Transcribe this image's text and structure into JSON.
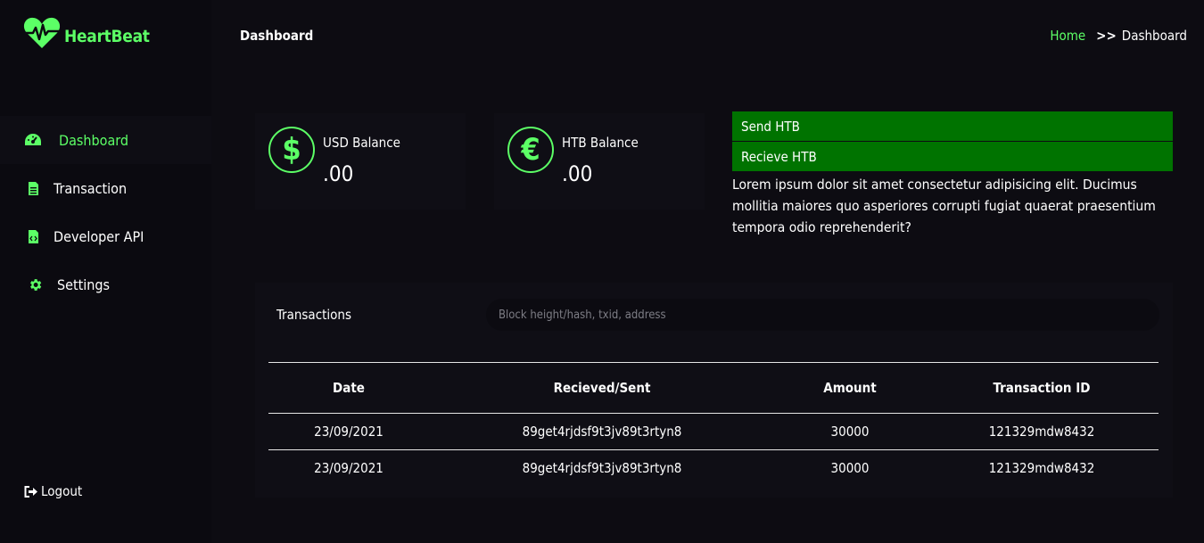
{
  "brand": {
    "name": "HeartBeat",
    "color": "#5cff66"
  },
  "header": {
    "title": "Dashboard",
    "breadcrumb": {
      "home": "Home",
      "separator": ">>",
      "current": "Dashboard"
    }
  },
  "sidebar": {
    "items": [
      {
        "label": "Dashboard",
        "icon": "speedometer-icon",
        "active": true
      },
      {
        "label": "Transaction",
        "icon": "document-icon",
        "active": false
      },
      {
        "label": "Developer API",
        "icon": "code-file-icon",
        "active": false
      },
      {
        "label": "Settings",
        "icon": "gear-icon",
        "active": false
      }
    ],
    "logout": "Logout"
  },
  "balances": {
    "usd": {
      "label": "USD Balance",
      "value": ".00",
      "icon": "dollar-icon",
      "symbol": "$"
    },
    "htb": {
      "label": "HTB Balance",
      "value": ".00",
      "icon": "euro-icon",
      "symbol": "€"
    }
  },
  "actions": {
    "send": "Send HTB",
    "receive": "Recieve HTB",
    "text": "Lorem ipsum dolor sit amet consectetur adipisicing elit. Ducimus mollitia maiores quo asperiores corrupti fugiat quaerat praesentium tempora odio reprehenderit?",
    "button_color": "#007300"
  },
  "transactions": {
    "title": "Transactions",
    "search_placeholder": "Block height/hash, txid, address",
    "columns": [
      "Date",
      "Recieved/Sent",
      "Amount",
      "Transaction ID"
    ],
    "rows": [
      [
        "23/09/2021",
        "89get4rjdsf9t3jv89t3rtyn8",
        "30000",
        "121329mdw8432"
      ],
      [
        "23/09/2021",
        "89get4rjdsf9t3jv89t3rtyn8",
        "30000",
        "121329mdw8432"
      ]
    ]
  }
}
